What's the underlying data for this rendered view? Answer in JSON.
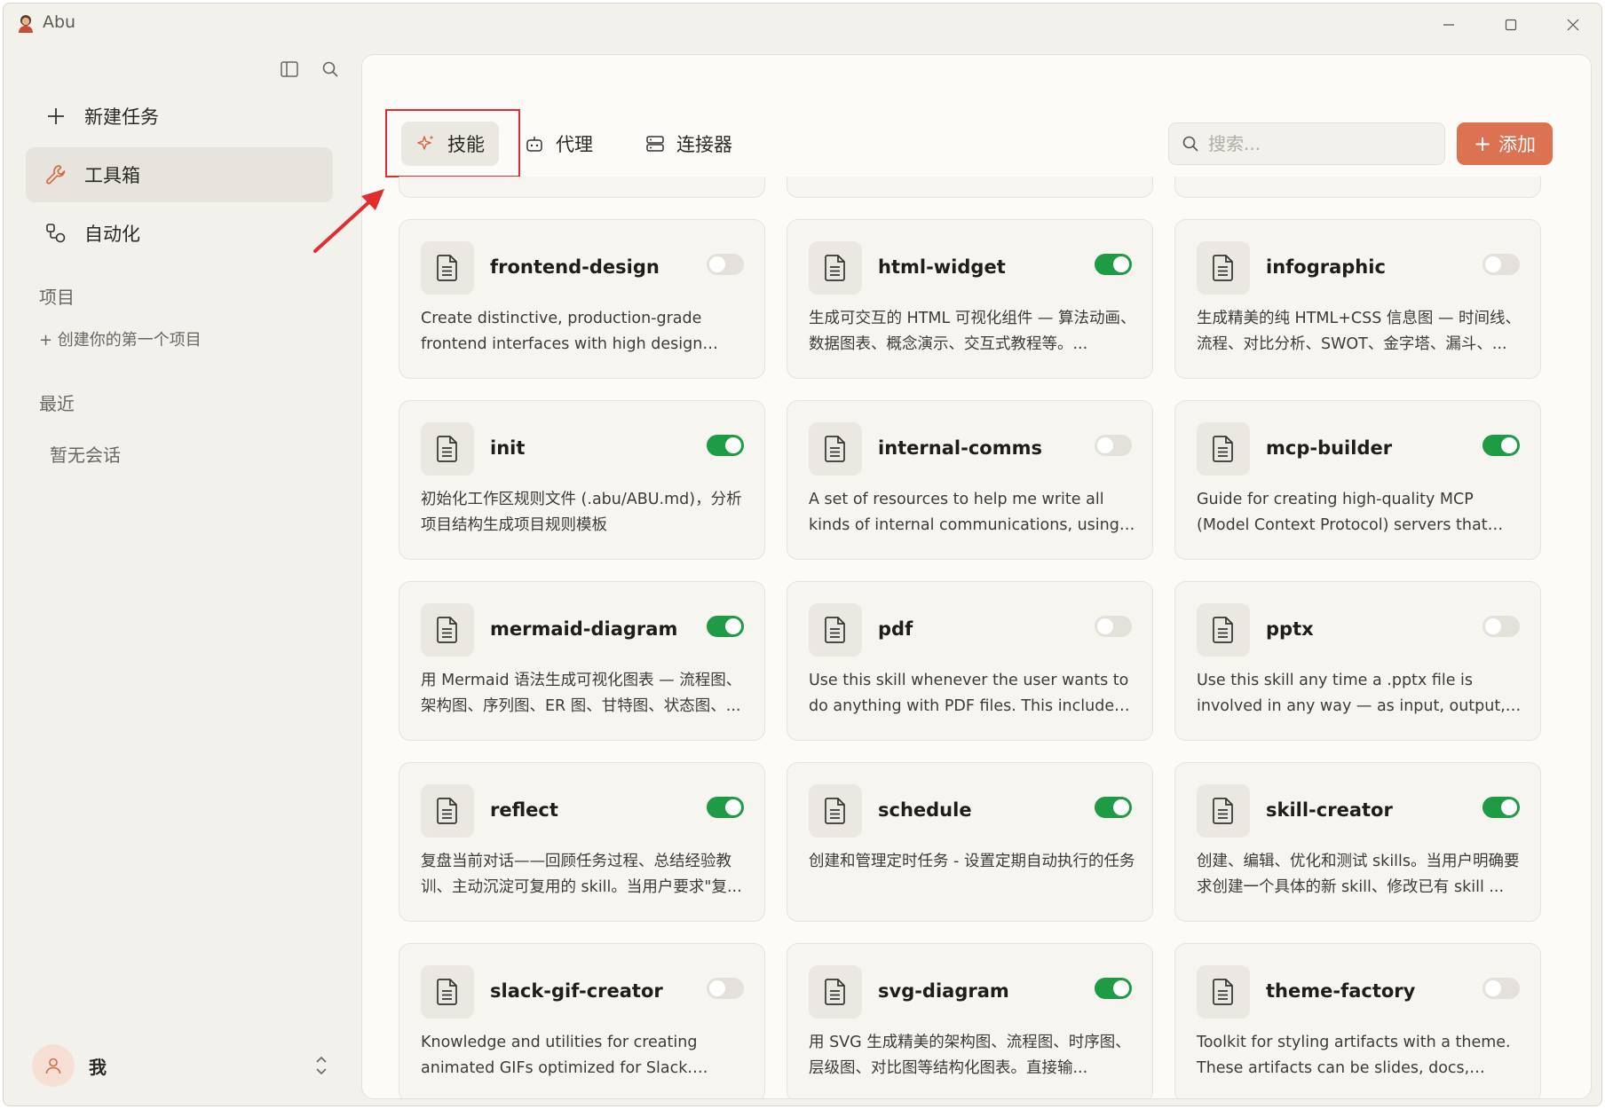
{
  "app": {
    "title": "Abu"
  },
  "sidebar": {
    "nav": [
      {
        "label": "新建任务",
        "icon": "plus-icon"
      },
      {
        "label": "工具箱",
        "icon": "wrench-icon"
      },
      {
        "label": "自动化",
        "icon": "automation-icon"
      }
    ],
    "projects_label": "项目",
    "create_project": "+ 创建你的第一个项目",
    "recent_label": "最近",
    "empty_conversations": "暂无会话",
    "user_name": "我"
  },
  "main": {
    "tabs": [
      {
        "label": "技能",
        "icon": "sparkle-icon"
      },
      {
        "label": "代理",
        "icon": "robot-icon"
      },
      {
        "label": "连接器",
        "icon": "server-icon"
      }
    ],
    "search_placeholder": "搜索...",
    "add_label": "添加"
  },
  "colors": {
    "accent": "#dd7252",
    "toggle_on": "#1f9a45",
    "toggle_off": "#e4e1da",
    "highlight": "#e02e2e"
  },
  "skills": [
    {
      "name": "frontend-design",
      "enabled": false,
      "desc": "Create distinctive, production-grade frontend interfaces with high design quality. Use this..."
    },
    {
      "name": "html-widget",
      "enabled": true,
      "desc": "生成可交互的 HTML 可视化组件 — 算法动画、数据图表、概念演示、交互式教程等。..."
    },
    {
      "name": "infographic",
      "enabled": false,
      "desc": "生成精美的纯 HTML+CSS 信息图 — 时间线、流程、对比分析、SWOT、金字塔、漏斗、..."
    },
    {
      "name": "init",
      "enabled": true,
      "desc": "初始化工作区规则文件 (.abu/ABU.md)，分析项目结构生成项目规则模板"
    },
    {
      "name": "internal-comms",
      "enabled": false,
      "desc": "A set of resources to help me write all kinds of internal communications, using the..."
    },
    {
      "name": "mcp-builder",
      "enabled": true,
      "desc": "Guide for creating high-quality MCP (Model Context Protocol) servers that enable LLMs ..."
    },
    {
      "name": "mermaid-diagram",
      "enabled": true,
      "desc": "用 Mermaid 语法生成可视化图表 — 流程图、架构图、序列图、ER 图、甘特图、状态图、..."
    },
    {
      "name": "pdf",
      "enabled": false,
      "desc": "Use this skill whenever the user wants to do anything with PDF files. This includes readin..."
    },
    {
      "name": "pptx",
      "enabled": false,
      "desc": "Use this skill any time a .pptx file is involved in any way — as input, output, or both. This..."
    },
    {
      "name": "reflect",
      "enabled": true,
      "desc": "复盘当前对话——回顾任务过程、总结经验教训、主动沉淀可复用的 skill。当用户要求\"复..."
    },
    {
      "name": "schedule",
      "enabled": true,
      "desc": "创建和管理定时任务 - 设置定期自动执行的任务"
    },
    {
      "name": "skill-creator",
      "enabled": true,
      "desc": "创建、编辑、优化和测试 skills。当用户明确要求创建一个具体的新 skill、修改已有 skill ..."
    },
    {
      "name": "slack-gif-creator",
      "enabled": false,
      "desc": "Knowledge and utilities for creating animated GIFs optimized for Slack. Provides constrain..."
    },
    {
      "name": "svg-diagram",
      "enabled": true,
      "desc": "用 SVG 生成精美的架构图、流程图、时序图、层级图、对比图等结构化图表。直接输..."
    },
    {
      "name": "theme-factory",
      "enabled": false,
      "desc": "Toolkit for styling artifacts with a theme. These artifacts can be slides, docs, reporting..."
    }
  ]
}
